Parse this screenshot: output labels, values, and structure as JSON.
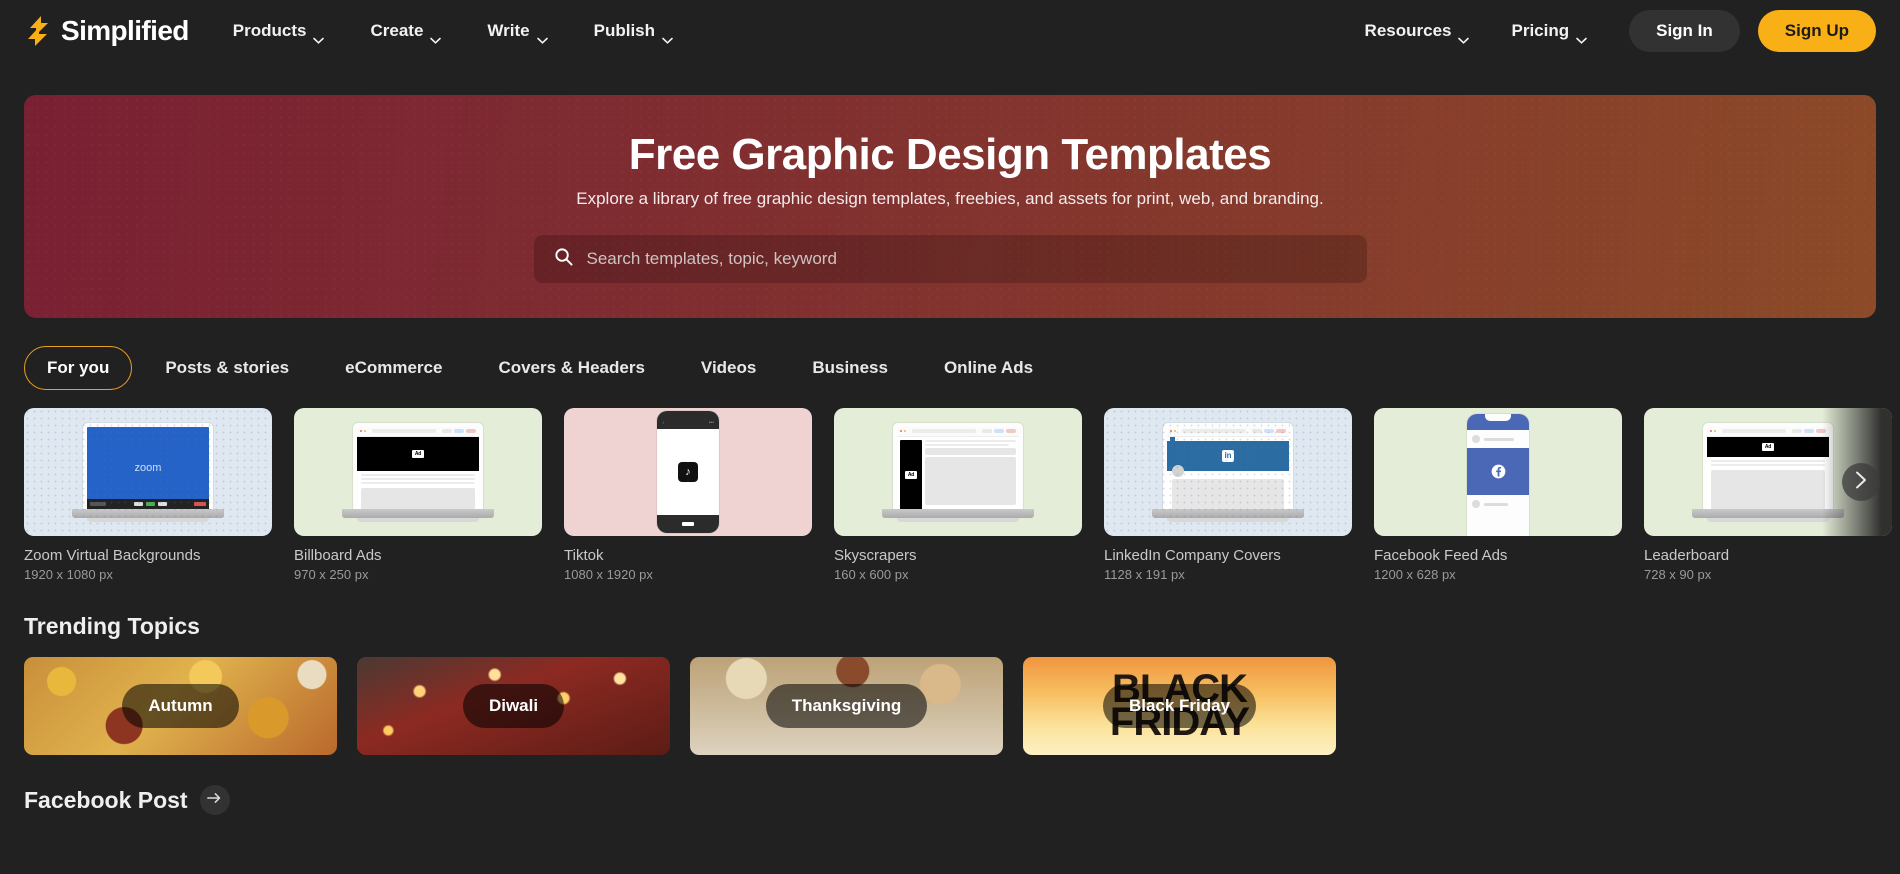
{
  "brand": {
    "name": "Simplified",
    "logo_icon": "lightning-bolt-logo",
    "logo_color": "#f9b016"
  },
  "navbar": {
    "links": [
      {
        "label": "Products",
        "icon": "chevron-down-icon"
      },
      {
        "label": "Create",
        "icon": "chevron-down-icon"
      },
      {
        "label": "Write",
        "icon": "chevron-down-icon"
      },
      {
        "label": "Publish",
        "icon": "chevron-down-icon"
      }
    ],
    "right_links": [
      {
        "label": "Resources",
        "icon": "chevron-down-icon"
      },
      {
        "label": "Pricing",
        "icon": "chevron-down-icon"
      }
    ],
    "sign_in": "Sign In",
    "sign_up": "Sign Up",
    "sign_up_color": "#f9b016"
  },
  "hero": {
    "title": "Free Graphic Design Templates",
    "subtitle": "Explore a library of free graphic design templates, freebies, and assets for print, web, and branding.",
    "search_placeholder": "Search templates, topic, keyword",
    "search_value": "",
    "search_icon": "search-icon",
    "gradient_from": "#7a2033",
    "gradient_to": "#8c4a28"
  },
  "tabs": {
    "active": "For you",
    "items": [
      "For you",
      "Posts & stories",
      "eCommerce",
      "Covers & Headers",
      "Videos",
      "Business",
      "Online Ads"
    ]
  },
  "templates": {
    "next_icon": "chevron-right-icon",
    "cards": [
      {
        "title": "Zoom Virtual Backgrounds",
        "dims": "1920 x 1080 px",
        "bg": "#dfe7f0",
        "art": "laptop-zoom",
        "dotted": true
      },
      {
        "title": "Billboard Ads",
        "dims": "970 x 250 px",
        "bg": "#e4edd7",
        "art": "laptop-billboard",
        "dotted": false
      },
      {
        "title": "Tiktok",
        "dims": "1080 x 1920 px",
        "bg": "#efd3d3",
        "art": "phone-tiktok",
        "dotted": false
      },
      {
        "title": "Skyscrapers",
        "dims": "160 x 600 px",
        "bg": "#e4edd7",
        "art": "laptop-skyscraper",
        "dotted": false
      },
      {
        "title": "LinkedIn Company Covers",
        "dims": "1128 x 191 px",
        "bg": "#dfe7f0",
        "art": "laptop-linkedin",
        "dotted": true
      },
      {
        "title": "Facebook Feed Ads",
        "dims": "1200 x 628 px",
        "bg": "#e4edd7",
        "art": "phone-facebook",
        "dotted": false
      },
      {
        "title": "Leaderboard",
        "dims": "728 x 90 px",
        "bg": "#e4edd7",
        "art": "laptop-billboard",
        "dotted": false
      }
    ]
  },
  "trending": {
    "heading": "Trending Topics",
    "topics": [
      {
        "label": "Autumn",
        "art": "autumn-leaves"
      },
      {
        "label": "Diwali",
        "art": "diwali-lamps"
      },
      {
        "label": "Thanksgiving",
        "art": "thanksgiving-wreath"
      },
      {
        "label": "Black Friday",
        "art": "black-friday-sunset"
      }
    ]
  },
  "footer_section": {
    "title": "Facebook Post",
    "arrow_icon": "arrow-right-icon"
  }
}
